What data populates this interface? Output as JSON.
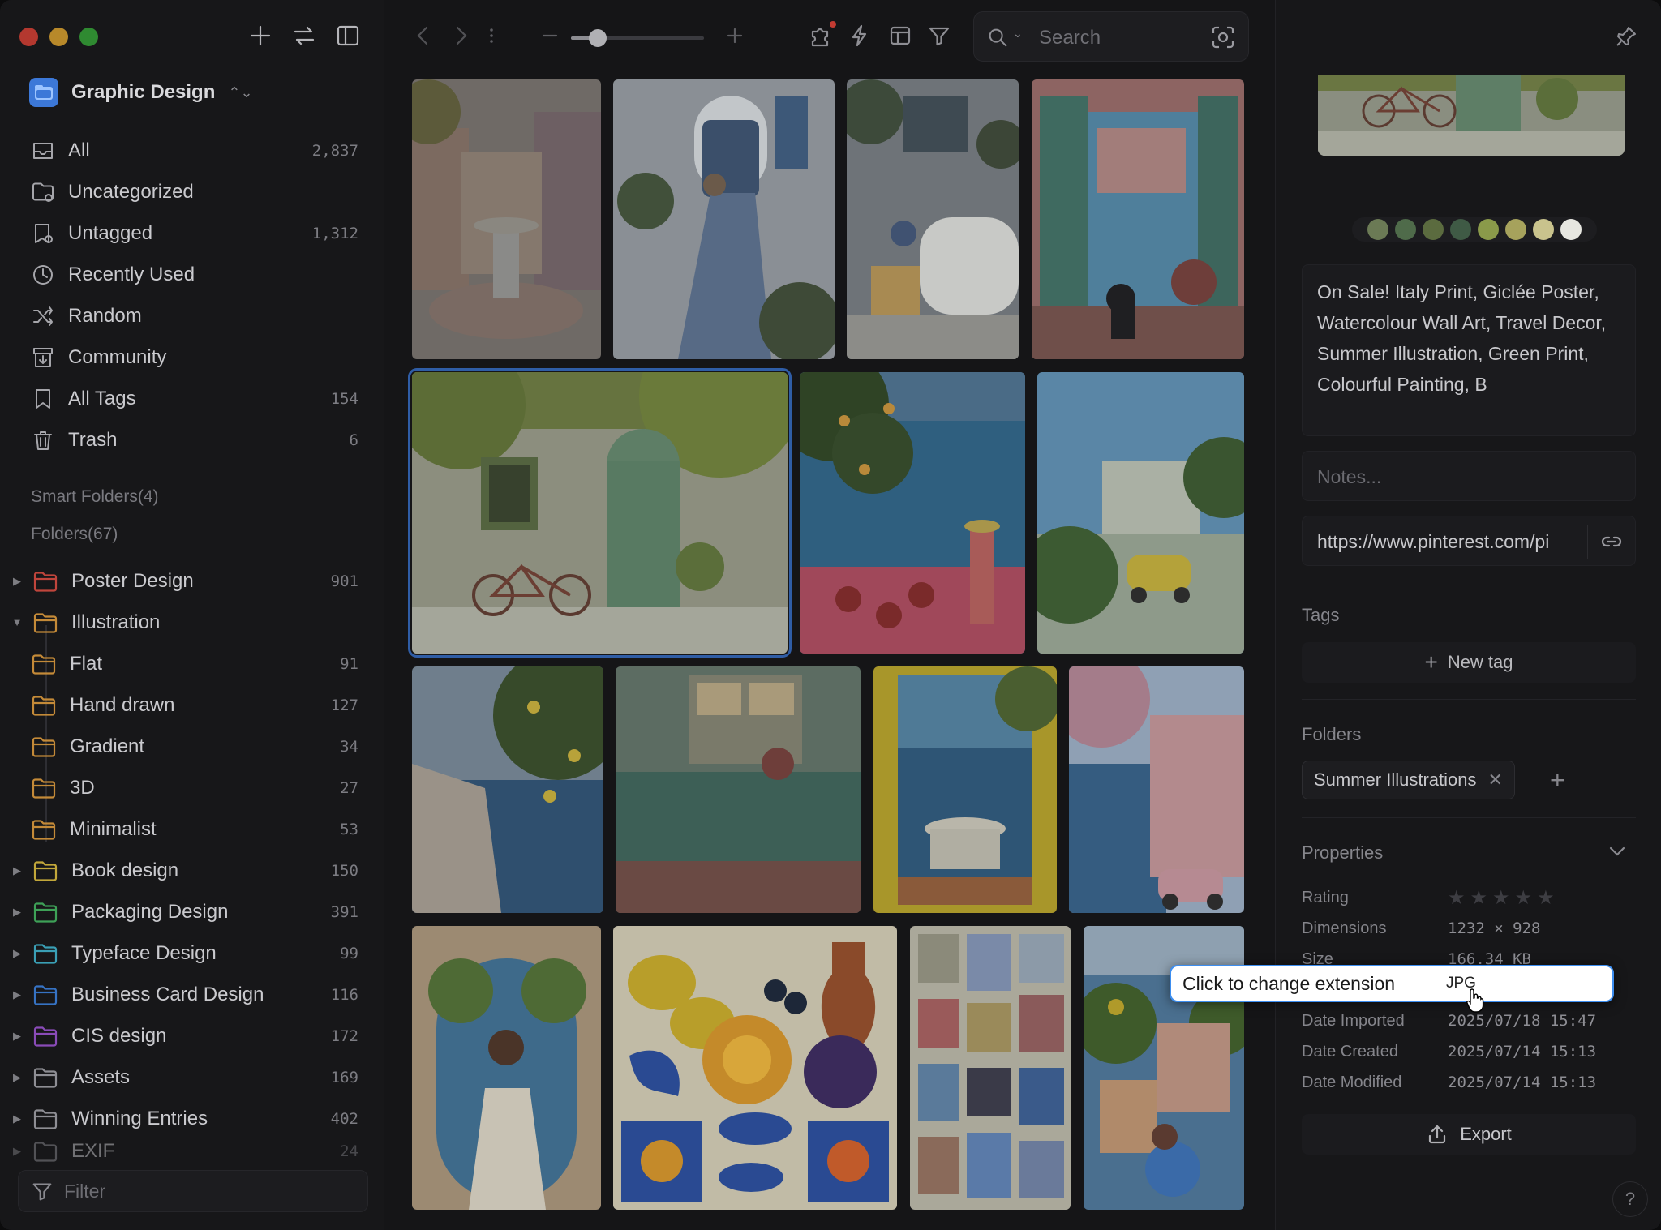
{
  "sidebar": {
    "library_name": "Graphic Design",
    "nav": [
      {
        "label": "All",
        "count": "2,837",
        "icon": "inbox-icon"
      },
      {
        "label": "Uncategorized",
        "count": "",
        "icon": "folder-question-icon"
      },
      {
        "label": "Untagged",
        "count": "1,312",
        "icon": "tag-question-icon"
      },
      {
        "label": "Recently Used",
        "count": "",
        "icon": "clock-icon"
      },
      {
        "label": "Random",
        "count": "",
        "icon": "shuffle-icon"
      },
      {
        "label": "Community",
        "count": "",
        "icon": "archive-down-icon"
      },
      {
        "label": "All Tags",
        "count": "154",
        "icon": "bookmark-icon"
      },
      {
        "label": "Trash",
        "count": "6",
        "icon": "trash-icon"
      }
    ],
    "smart_folders_label": "Smart Folders(4)",
    "folders_label": "Folders(67)",
    "folders": [
      {
        "label": "Poster Design",
        "count": "901",
        "color": "#c0453c",
        "expander": "▶",
        "level": 0
      },
      {
        "label": "Illustration",
        "count": "",
        "color": "#c48a38",
        "expander": "▼",
        "level": 0
      },
      {
        "label": "Flat",
        "count": "91",
        "color": "#c48a38",
        "expander": "",
        "level": 1
      },
      {
        "label": "Hand drawn",
        "count": "127",
        "color": "#c48a38",
        "expander": "",
        "level": 1
      },
      {
        "label": "Gradient",
        "count": "34",
        "color": "#c48a38",
        "expander": "",
        "level": 1
      },
      {
        "label": "3D",
        "count": "27",
        "color": "#c48a38",
        "expander": "",
        "level": 1
      },
      {
        "label": "Minimalist",
        "count": "53",
        "color": "#c48a38",
        "expander": "",
        "level": 1
      },
      {
        "label": "Book design",
        "count": "150",
        "color": "#c2a73a",
        "expander": "▶",
        "level": 0
      },
      {
        "label": "Packaging Design",
        "count": "391",
        "color": "#3ea157",
        "expander": "▶",
        "level": 0
      },
      {
        "label": "Typeface Design",
        "count": "99",
        "color": "#3a9fb5",
        "expander": "▶",
        "level": 0
      },
      {
        "label": "Business Card Design",
        "count": "116",
        "color": "#3673c4",
        "expander": "▶",
        "level": 0
      },
      {
        "label": "CIS design",
        "count": "172",
        "color": "#8a4bb8",
        "expander": "▶",
        "level": 0
      },
      {
        "label": "Assets",
        "count": "169",
        "color": "#8e8e94",
        "expander": "▶",
        "level": 0
      },
      {
        "label": "Winning Entries",
        "count": "402",
        "color": "#8e8e94",
        "expander": "▶",
        "level": 0
      }
    ],
    "filter_placeholder": "Filter"
  },
  "toolbar": {
    "search_placeholder": "Search",
    "zoom_level": 0.2
  },
  "inspector": {
    "palette": [
      "#6b7a55",
      "#4f6b4a",
      "#5b6b3f",
      "#3f5a45",
      "#8a9a4a",
      "#a6a25c",
      "#c9c38d",
      "#e6e6e0"
    ],
    "description": "On Sale! Italy Print, Giclée Poster, Watercolour Wall Art, Travel Decor, Summer Illustration, Green Print, Colourful Painting, B",
    "notes_placeholder": "Notes...",
    "url": "https://www.pinterest.com/pi",
    "tags_label": "Tags",
    "new_tag_label": "New tag",
    "folders_label": "Folders",
    "folder_chip": "Summer Illustrations",
    "properties_label": "Properties",
    "properties": {
      "rating_label": "Rating",
      "rating": 0,
      "dimensions_label": "Dimensions",
      "dimensions": "1232 × 928",
      "size_label": "Size",
      "size": "166.34 KB",
      "imported_label": "Date Imported",
      "imported": "2025/07/18 15:47",
      "created_label": "Date Created",
      "created": "2025/07/14 15:13",
      "modified_label": "Date Modified",
      "modified": "2025/07/14 15:13"
    },
    "export_label": "Export",
    "help_label": "?"
  },
  "ext_popup": {
    "tooltip": "Click to change extension",
    "value": "JPG"
  }
}
